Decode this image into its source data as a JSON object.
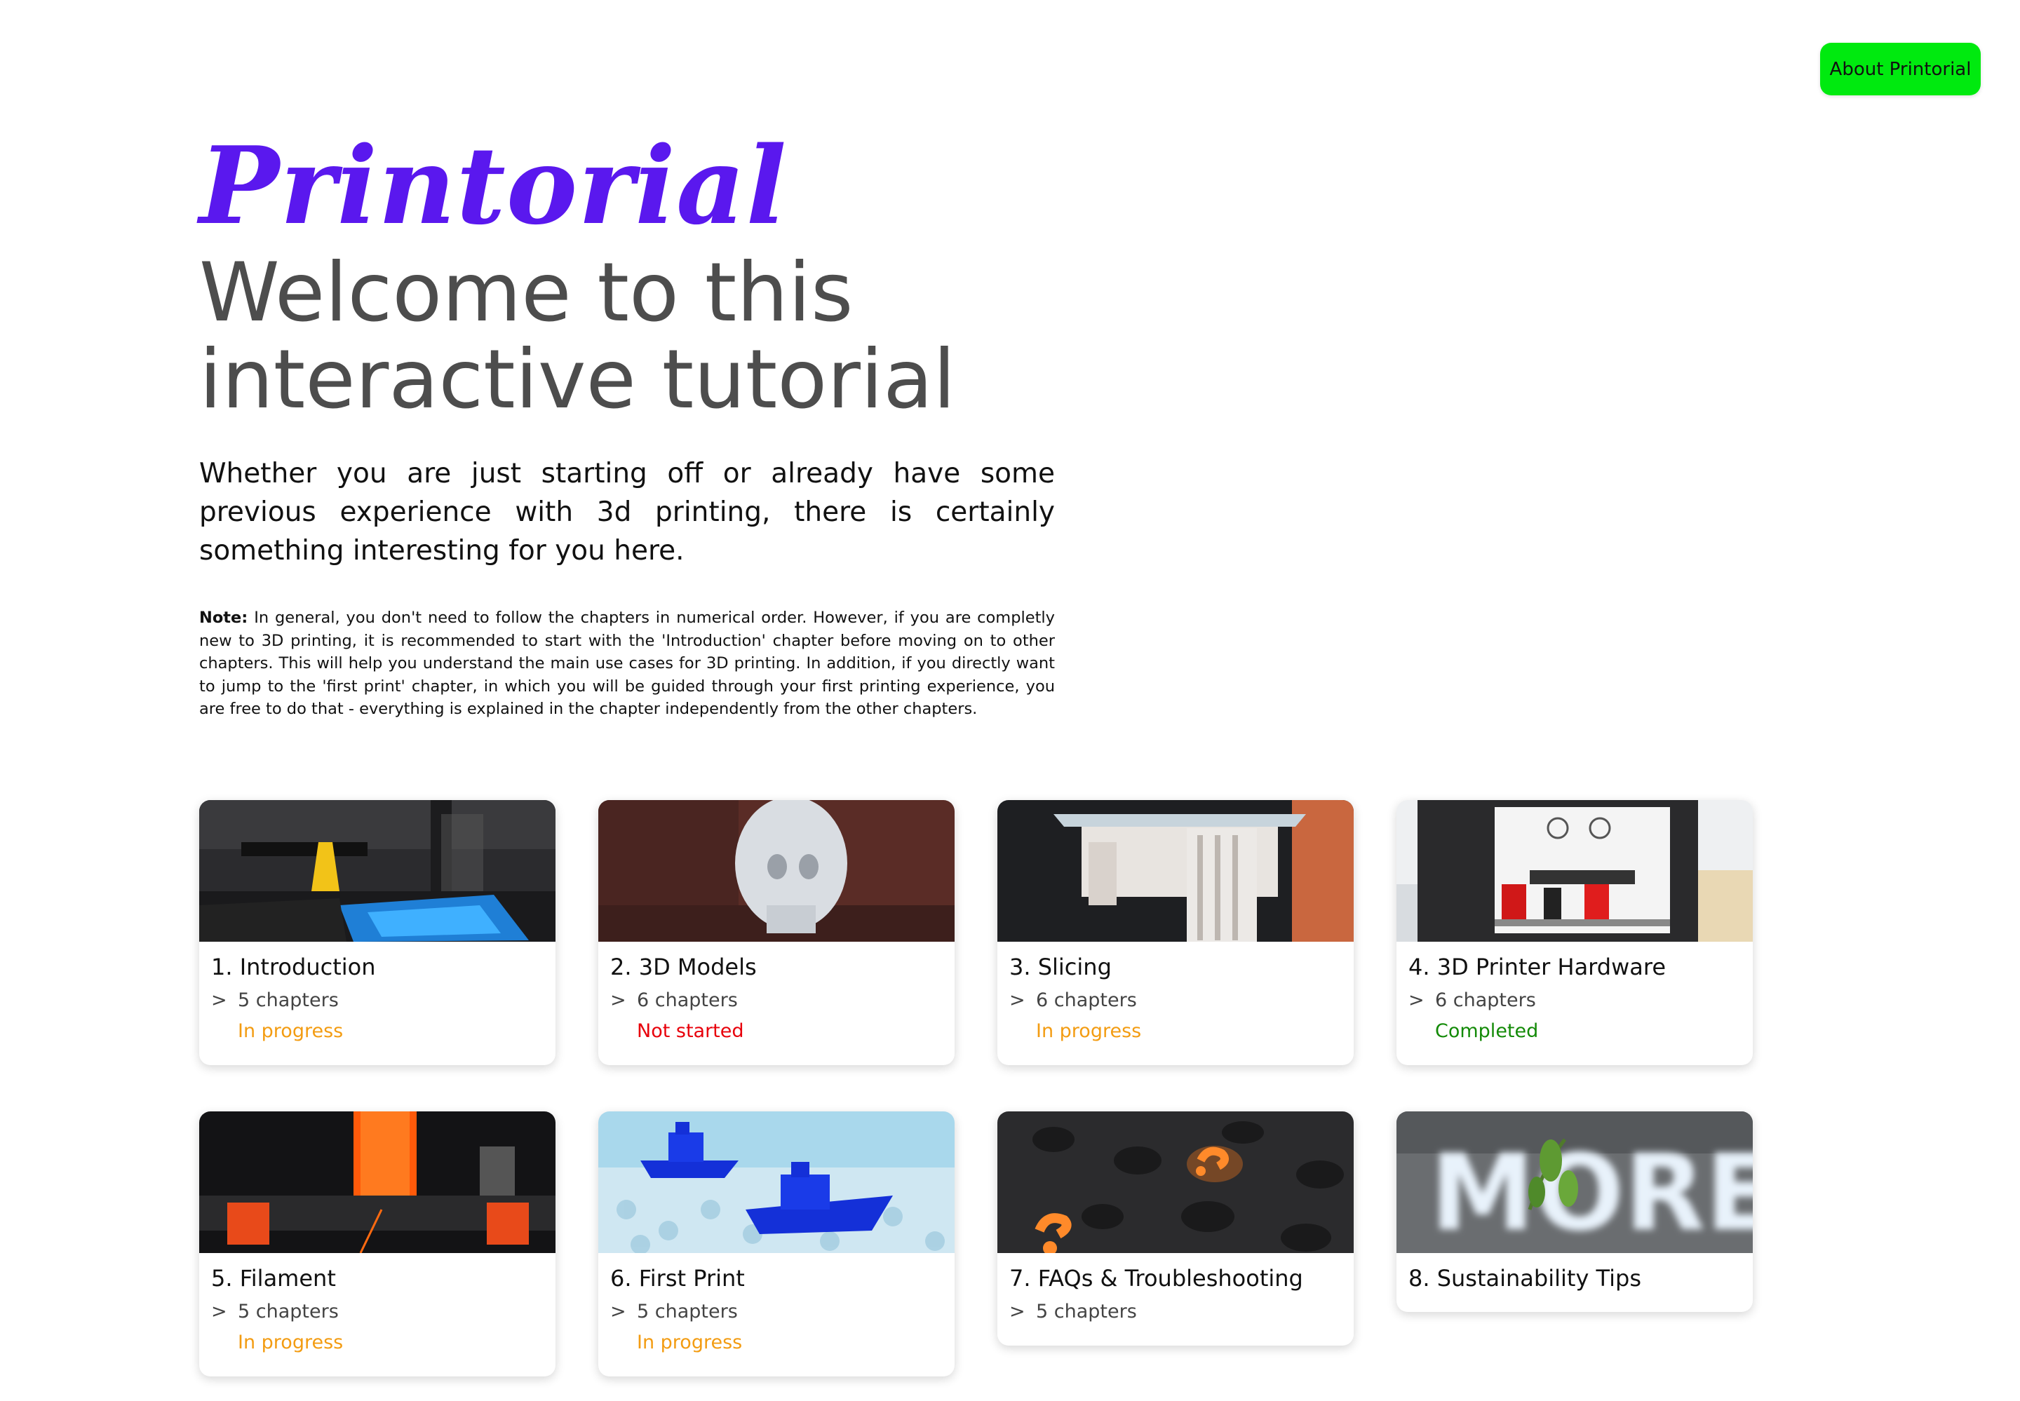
{
  "header": {
    "about_label": "About Printorial"
  },
  "hero": {
    "brand": "Printorial",
    "title_line1": "Welcome to this",
    "title_line2": "interactive tutorial",
    "lead": "Whether you are just starting off or already have some previous experience with 3d printing, there is certainly something interesting for you here.",
    "note_label": "Note:",
    "note_text": " In general, you don't need to follow the chapters in numerical order. However, if you are completly new to 3D printing, it is recommended to start with the 'Introduction' chapter before moving on to other chapters. This will help you understand the main use cases for 3D printing. In addition, if you directly want to jump to the 'first print' chapter, in which you will be guided through your first printing experience, you are free to do that - everything is explained in the chapter independently from the other chapters."
  },
  "cards": [
    {
      "title": "1. Introduction",
      "arrow": ">",
      "chapters": "5 chapters",
      "status": "In progress",
      "image": "3d-printer-nozzle-image"
    },
    {
      "title": "2. 3D Models",
      "arrow": ">",
      "chapters": "6 chapters",
      "status": "Not started",
      "image": "printed-head-model-image"
    },
    {
      "title": "3. Slicing",
      "arrow": ">",
      "chapters": "6 chapters",
      "status": "In progress",
      "image": "resin-print-image"
    },
    {
      "title": "4. 3D Printer Hardware",
      "arrow": ">",
      "chapters": "6 chapters",
      "status": "Completed",
      "image": "dual-extruder-printer-image"
    },
    {
      "title": "5. Filament",
      "arrow": ">",
      "chapters": "5 chapters",
      "status": "In progress",
      "image": "filament-spool-image"
    },
    {
      "title": "6. First Print",
      "arrow": ">",
      "chapters": "5 chapters",
      "status": "In progress",
      "image": "benchy-boats-image"
    },
    {
      "title": "7. FAQs & Troubleshooting",
      "arrow": ">",
      "chapters": "5 chapters",
      "image": "question-marks-image"
    },
    {
      "title": "8. Sustainability Tips",
      "image": "more-sign-image"
    }
  ],
  "colors": {
    "brand": "#5a18ee",
    "about_button": "#00ea0f",
    "in_progress": "#f39c12",
    "not_started": "#e8000b",
    "completed": "#138a07"
  }
}
